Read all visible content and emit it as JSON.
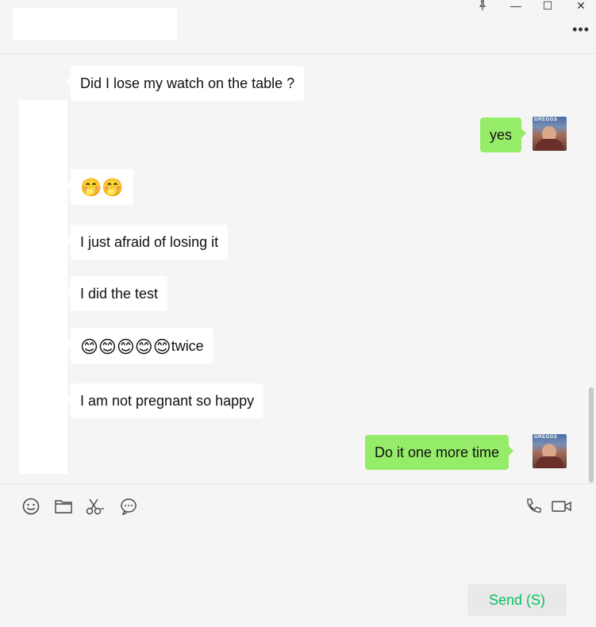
{
  "header": {
    "title": "",
    "controls": {
      "pin": "pin-icon",
      "minimize": "—",
      "maximize": "☐",
      "close": "✕",
      "more": "•••"
    }
  },
  "messages": [
    {
      "side": "in",
      "text": "Did I lose my watch on the table ?"
    },
    {
      "side": "out",
      "text": "yes"
    },
    {
      "side": "in",
      "emoji": "🤭🤭"
    },
    {
      "side": "in",
      "text": "I just afraid of losing it"
    },
    {
      "side": "in",
      "text": "I did the test"
    },
    {
      "side": "in",
      "emoji": "😊😊😊😊😊",
      "text": "twice"
    },
    {
      "side": "in",
      "text": "I am not pregnant so happy"
    },
    {
      "side": "out",
      "text": "Do it one more time"
    }
  ],
  "avatar": {
    "label": "GREGGS"
  },
  "toolbar": {
    "icons": [
      "emoji-icon",
      "folder-icon",
      "scissors-icon",
      "chat-bubble-icon",
      "phone-icon",
      "video-call-icon"
    ],
    "send_label": "Send (S)"
  },
  "colors": {
    "out_bubble": "#95ec69",
    "in_bubble": "#ffffff",
    "send_text": "#07c160",
    "background": "#f5f5f5"
  }
}
